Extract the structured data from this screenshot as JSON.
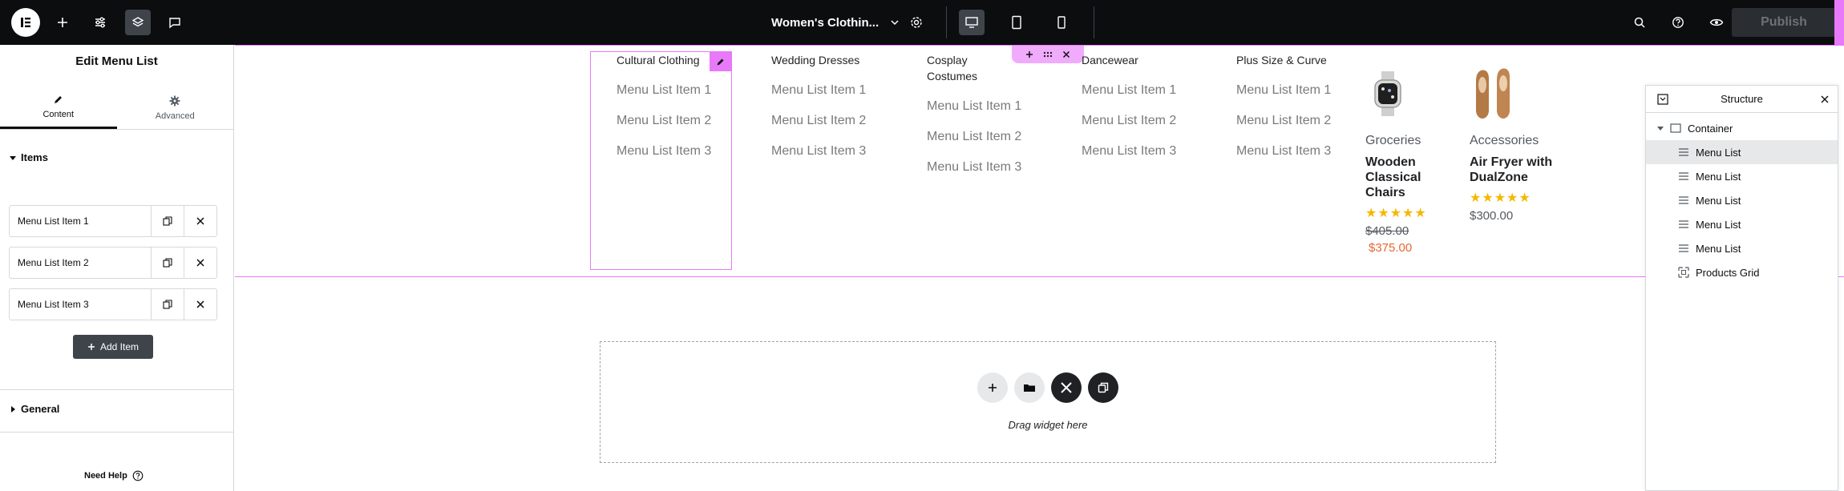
{
  "topbar": {
    "document_title": "Women's Clothin...",
    "publish_label": "Publish"
  },
  "panel": {
    "title": "Edit Menu List",
    "tabs": [
      {
        "label": "Content",
        "icon": "pencil-icon"
      },
      {
        "label": "Advanced",
        "icon": "gear-icon"
      }
    ],
    "items_section": "Items",
    "items": [
      "Menu List Item 1",
      "Menu List Item 2",
      "Menu List Item 3"
    ],
    "add_item_label": "Add Item",
    "general_section": "General",
    "need_help": "Need Help"
  },
  "canvas": {
    "menus": [
      {
        "heading": "Cultural Clothing",
        "items": [
          "Menu List Item 1",
          "Menu List Item 2",
          "Menu List Item 3"
        ]
      },
      {
        "heading": "Wedding Dresses",
        "items": [
          "Menu List Item 1",
          "Menu List Item 2",
          "Menu List Item 3"
        ]
      },
      {
        "heading": "Cosplay Costumes",
        "items": [
          "Menu List Item 1",
          "Menu List Item 2",
          "Menu List Item 3"
        ]
      },
      {
        "heading": "Dancewear",
        "items": [
          "Menu List Item 1",
          "Menu List Item 2",
          "Menu List Item 3"
        ]
      },
      {
        "heading": "Plus Size & Curve",
        "items": [
          "Menu List Item 1",
          "Menu List Item 2",
          "Menu List Item 3"
        ]
      }
    ],
    "products": [
      {
        "category": "Groceries",
        "name": "Wooden Classical Chairs",
        "stars": "★★★★★",
        "old_price": "$405.00",
        "sale_price": "$375.00"
      },
      {
        "category": "Accessories",
        "name": "Air Fryer with DualZone",
        "stars": "★★★★★",
        "price": "$300.00"
      }
    ],
    "drop_text": "Drag widget here"
  },
  "structure": {
    "title": "Structure",
    "root": "Container",
    "children": [
      "Menu List",
      "Menu List",
      "Menu List",
      "Menu List",
      "Menu List",
      "Products Grid"
    ]
  },
  "colors": {
    "accent_pink": "#e879f9",
    "topbar_bg": "#0c0d0e",
    "star": "#f5b800",
    "sale": "#e86731"
  }
}
